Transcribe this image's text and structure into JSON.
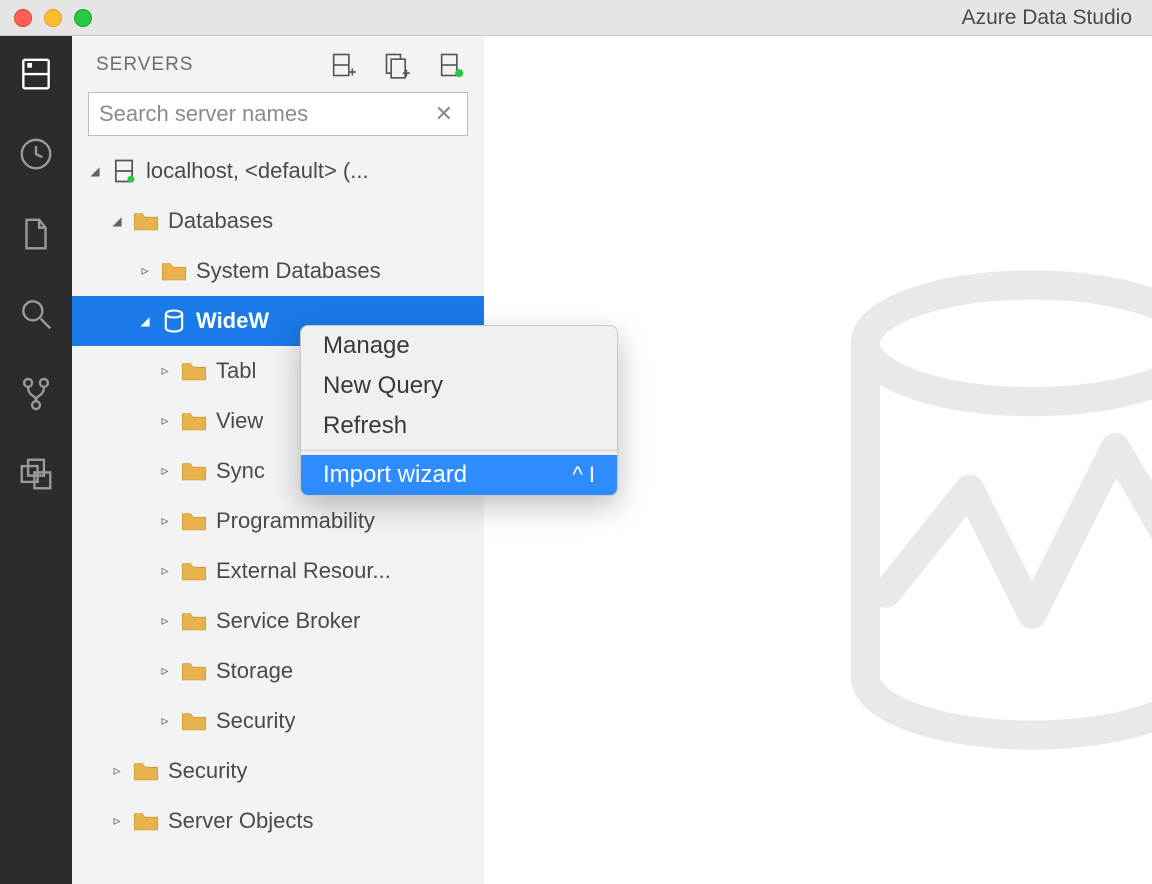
{
  "window": {
    "title": "Azure Data Studio"
  },
  "activitybar": {
    "items": [
      {
        "name": "servers-icon"
      },
      {
        "name": "history-icon"
      },
      {
        "name": "file-icon"
      },
      {
        "name": "search-icon"
      },
      {
        "name": "source-control-icon"
      },
      {
        "name": "extensions-icon"
      }
    ]
  },
  "sidebar": {
    "title": "SERVERS",
    "search_placeholder": "Search server names",
    "tree": {
      "server_label": "localhost, <default> (...",
      "databases_label": "Databases",
      "system_databases_label": "System Databases",
      "selected_db_label": "WideW",
      "db_children": [
        "Tabl",
        "View",
        "Sync",
        "Programmability",
        "External Resour...",
        "Service Broker",
        "Storage",
        "Security"
      ],
      "security_label": "Security",
      "server_objects_label": "Server Objects"
    }
  },
  "context_menu": {
    "items": [
      {
        "label": "Manage",
        "shortcut": ""
      },
      {
        "label": "New Query",
        "shortcut": ""
      },
      {
        "label": "Refresh",
        "shortcut": ""
      }
    ],
    "highlighted": {
      "label": "Import wizard",
      "shortcut": "^ I"
    }
  }
}
